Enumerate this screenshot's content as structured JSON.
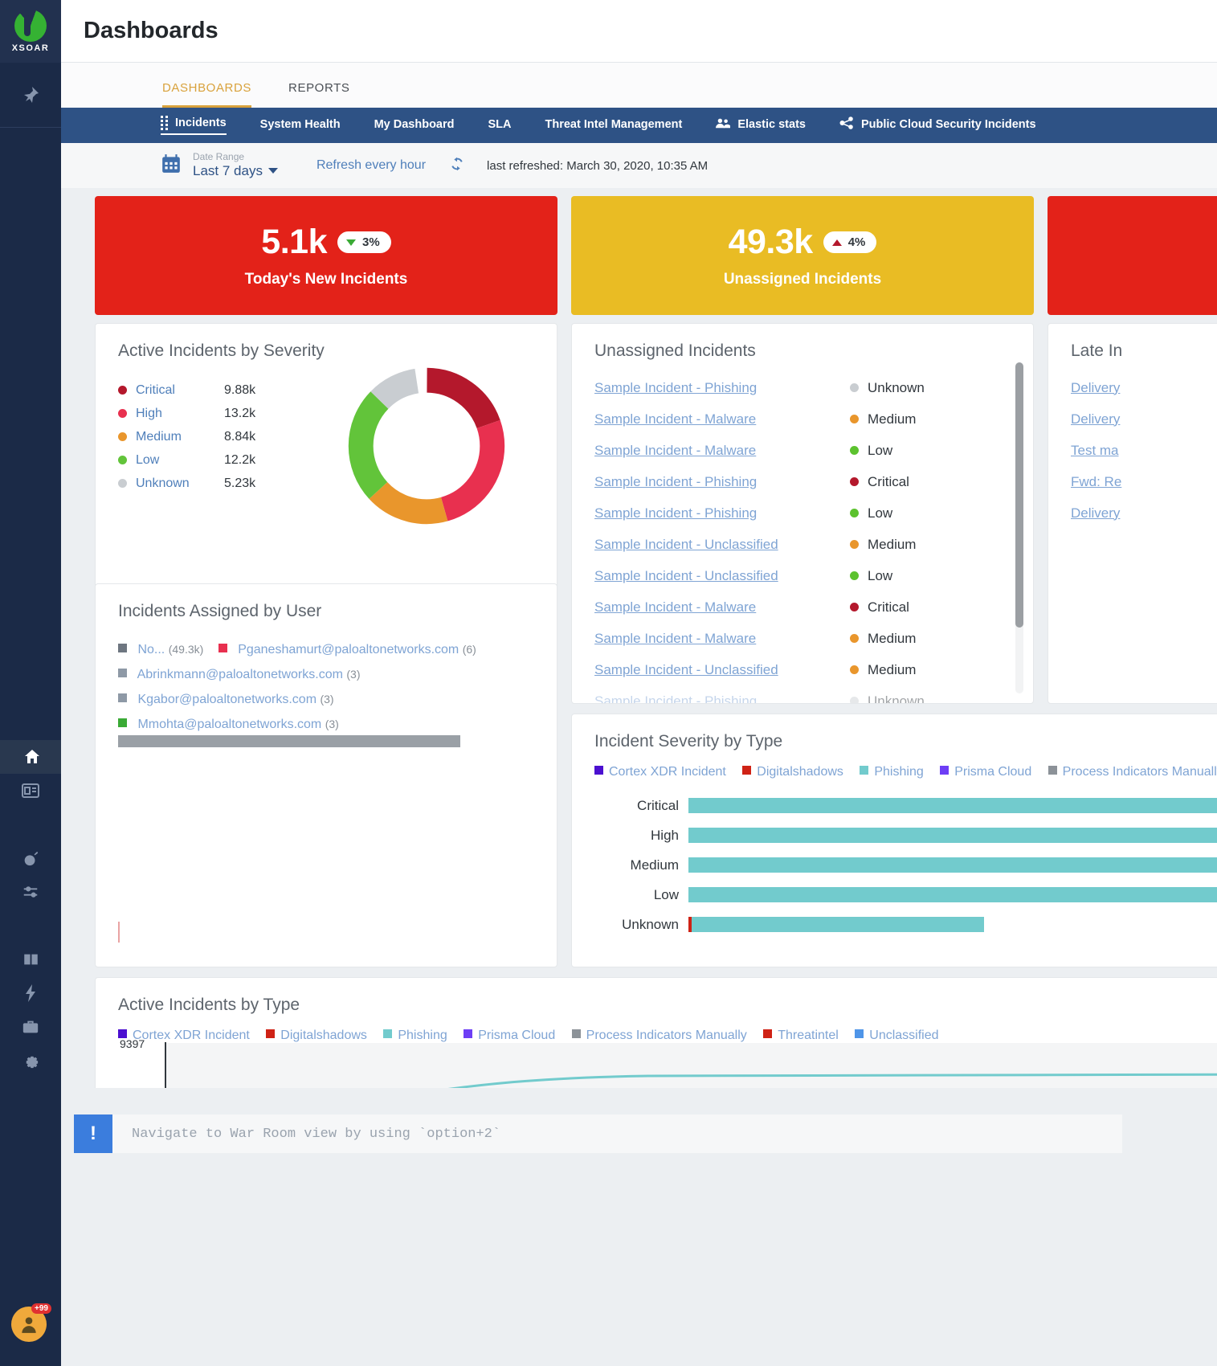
{
  "app": {
    "brand": "XSOAR",
    "page_title": "Dashboards",
    "accent_gold": "#d9a23c",
    "nav_blue": "#2e5285",
    "link_blue": "#4f7fba"
  },
  "rail": {
    "items": [
      {
        "name": "pin-icon",
        "label": "Pin"
      },
      {
        "name": "home-icon",
        "label": "Home"
      },
      {
        "name": "dashboard-icon",
        "label": "Dashboards"
      },
      {
        "name": "bomb-icon",
        "label": "Incidents"
      },
      {
        "name": "sliders-icon",
        "label": "Indicators"
      },
      {
        "name": "book-icon",
        "label": "Playbooks"
      },
      {
        "name": "bolt-icon",
        "label": "Automation"
      },
      {
        "name": "briefcase-icon",
        "label": "Marketplace"
      },
      {
        "name": "gear-icon",
        "label": "Settings"
      }
    ],
    "avatar_badge": "+99"
  },
  "top_tabs": [
    {
      "label": "DASHBOARDS",
      "active": true
    },
    {
      "label": "REPORTS",
      "active": false
    }
  ],
  "dashboard_nav": [
    {
      "label": "Incidents",
      "icon": "grid-dots-icon",
      "active": true
    },
    {
      "label": "System Health",
      "icon": "",
      "active": false
    },
    {
      "label": "My Dashboard",
      "icon": "",
      "active": false
    },
    {
      "label": "SLA",
      "icon": "",
      "active": false
    },
    {
      "label": "Threat Intel Management",
      "icon": "",
      "active": false
    },
    {
      "label": "Elastic stats",
      "icon": "users-icon",
      "active": false
    },
    {
      "label": "Public Cloud Security Incidents",
      "icon": "share-icon",
      "active": false
    }
  ],
  "date_bar": {
    "calendar_icon": "calendar-icon",
    "range_label": "Date Range",
    "range_value": "Last 7 days",
    "refresh_label": "Refresh every hour",
    "refresh_icon": "refresh-icon",
    "last_refreshed": "last refreshed: March 30, 2020, 10:35 AM"
  },
  "kpis": [
    {
      "value": "5.1k",
      "delta": "3%",
      "direction": "down",
      "label": "Today's New Incidents",
      "color": "#e32219"
    },
    {
      "value": "49.3k",
      "delta": "4%",
      "direction": "up",
      "label": "Unassigned Incidents",
      "color": "#e9bc24"
    },
    {
      "value": "",
      "delta": "",
      "direction": "",
      "label": "",
      "color": "#e32219"
    }
  ],
  "severity_card": {
    "title": "Active Incidents by Severity",
    "rows": [
      {
        "name": "Critical",
        "value": "9.88k",
        "color": "#b4182c",
        "pct": 19.5
      },
      {
        "name": "High",
        "value": "13.2k",
        "color": "#e8304f",
        "pct": 26.1
      },
      {
        "name": "Medium",
        "value": "8.84k",
        "color": "#e9962c",
        "pct": 17.5
      },
      {
        "name": "Low",
        "value": "12.2k",
        "color": "#62c43a",
        "pct": 24.1
      },
      {
        "name": "Unknown",
        "value": "5.23k",
        "color": "#c9cdd1",
        "pct": 10.3
      }
    ]
  },
  "assigned_card": {
    "title": "Incidents Assigned by User",
    "rows": [
      {
        "name": "No...",
        "count": "(49.3k)",
        "color": "#6e7680",
        "inline": true
      },
      {
        "name": "Pganeshamurt@paloaltonetworks.com",
        "count": "(6)",
        "color": "#e8304f",
        "inline": true
      },
      {
        "name": "Abrinkmann@paloaltonetworks.com",
        "count": "(3)",
        "color": "#8e99a6",
        "inline": false
      },
      {
        "name": "Kgabor@paloaltonetworks.com",
        "count": "(3)",
        "color": "#8e99a6",
        "inline": false
      },
      {
        "name": "Mmohta@paloaltonetworks.com",
        "count": "(3)",
        "color": "#3aaa35",
        "inline": false
      }
    ],
    "bar_color": "#9aa0a6"
  },
  "unassigned_card": {
    "title": "Unassigned Incidents",
    "rows": [
      {
        "name": "Sample Incident - Phishing",
        "severity": "Unknown",
        "color": "#c9cdd1"
      },
      {
        "name": "Sample Incident - Malware",
        "severity": "Medium",
        "color": "#e9962c"
      },
      {
        "name": "Sample Incident - Malware",
        "severity": "Low",
        "color": "#5cc22e"
      },
      {
        "name": "Sample Incident - Phishing",
        "severity": "Critical",
        "color": "#b4182c"
      },
      {
        "name": "Sample Incident - Phishing",
        "severity": "Low",
        "color": "#5cc22e"
      },
      {
        "name": "Sample Incident - Unclassified",
        "severity": "Medium",
        "color": "#e9962c"
      },
      {
        "name": "Sample Incident - Unclassified",
        "severity": "Low",
        "color": "#5cc22e"
      },
      {
        "name": "Sample Incident - Malware",
        "severity": "Critical",
        "color": "#b4182c"
      },
      {
        "name": "Sample Incident - Malware",
        "severity": "Medium",
        "color": "#e9962c"
      },
      {
        "name": "Sample Incident - Unclassified",
        "severity": "Medium",
        "color": "#e9962c"
      },
      {
        "name": "Sample Incident - Phishing",
        "severity": "Unknown",
        "color": "#c9cdd1"
      }
    ]
  },
  "late_card": {
    "title": "Late In",
    "rows": [
      {
        "name": "Delivery"
      },
      {
        "name": "Delivery"
      },
      {
        "name": "Test ma"
      },
      {
        "name": "Fwd: Re"
      },
      {
        "name": "Delivery"
      }
    ]
  },
  "chart_data": [
    {
      "type": "pie",
      "title": "Active Incidents by Severity",
      "labels": [
        "Critical",
        "High",
        "Medium",
        "Low",
        "Unknown"
      ],
      "values": [
        9880,
        13200,
        8840,
        12200,
        5230
      ],
      "value_labels": [
        "9.88k",
        "13.2k",
        "8.84k",
        "12.2k",
        "5.23k"
      ],
      "colors": [
        "#b4182c",
        "#e8304f",
        "#e9962c",
        "#62c43a",
        "#c9cdd1"
      ],
      "donut": true,
      "legend": "left"
    },
    {
      "type": "bar",
      "orientation": "horizontal",
      "stacked": true,
      "title": "Incident Severity by Type",
      "categories": [
        "Critical",
        "High",
        "Medium",
        "Low",
        "Unknown"
      ],
      "series": [
        {
          "name": "Cortex XDR Incident",
          "color": "#4b0fd0",
          "values": [
            0,
            0,
            0,
            0,
            0
          ]
        },
        {
          "name": "Digitalshadows",
          "color": "#cf2215",
          "values": [
            0,
            0,
            0,
            0,
            6
          ]
        },
        {
          "name": "Phishing",
          "color": "#72cbcd",
          "values": [
            100,
            100,
            100,
            100,
            94
          ]
        },
        {
          "name": "Prisma Cloud",
          "color": "#6d3ef5",
          "values": [
            0,
            0,
            0,
            0,
            0
          ]
        },
        {
          "name": "Process Indicators Manually",
          "color": "#8c9298",
          "values": [
            0,
            0,
            0,
            0,
            0
          ]
        }
      ],
      "grid": false,
      "legend": "top",
      "xlabel": "",
      "ylabel": ""
    },
    {
      "type": "line",
      "title": "Active Incidents by Type",
      "series": [
        {
          "name": "Cortex XDR Incident",
          "color": "#4b0fd0"
        },
        {
          "name": "Digitalshadows",
          "color": "#cf2215"
        },
        {
          "name": "Phishing",
          "color": "#72cbcd"
        },
        {
          "name": "Prisma Cloud",
          "color": "#6d3ef5"
        },
        {
          "name": "Process Indicators Manually",
          "color": "#8c9298"
        },
        {
          "name": "Threatintel",
          "color": "#cf2215"
        },
        {
          "name": "Unclassified",
          "color": "#4f95e8"
        }
      ],
      "y_max_label": "9397",
      "ylim": [
        0,
        9397
      ],
      "grid": true,
      "legend": "top"
    }
  ],
  "severity_type_card": {
    "title": "Incident Severity by Type"
  },
  "active_type_card": {
    "title": "Active Incidents by Type",
    "y_top_label": "9397"
  },
  "toast": {
    "badge": "!",
    "message": "Navigate to War Room view by using `option+2`"
  }
}
